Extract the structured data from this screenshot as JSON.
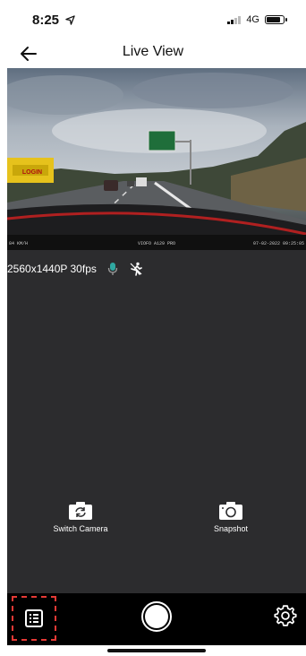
{
  "status_bar": {
    "time": "8:25",
    "network": "4G"
  },
  "nav": {
    "title": "Live View",
    "back_icon": "arrow-left-icon"
  },
  "video": {
    "overlay_left": "84 KM/H",
    "overlay_center": "VIOFO A129 PRO",
    "overlay_right": "07-02-2022 09:25:05",
    "sign_text": "LOGIN"
  },
  "camera_info": {
    "resolution": "2560x1440P 30fps",
    "mic_icon": "microphone-icon",
    "motion_icon": "running-person-icon"
  },
  "actions": {
    "switch_camera_label": "Switch Camera",
    "snapshot_label": "Snapshot"
  },
  "bottom_bar": {
    "gallery_icon": "file-list-icon",
    "record_icon": "record-button-icon",
    "settings_icon": "gear-icon"
  },
  "colors": {
    "panel_bg": "#2c2c2e",
    "bottom_bar_bg": "#000000",
    "highlight": "#e53935",
    "mic_accent": "#2fa7a0"
  }
}
